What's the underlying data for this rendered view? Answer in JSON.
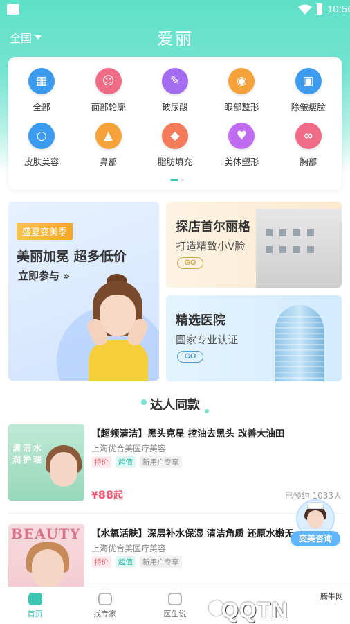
{
  "status_bar": {
    "time": "10:56"
  },
  "header": {
    "city": "全国",
    "title": "爱丽"
  },
  "categories": [
    {
      "label": "全部",
      "icon": "grid-icon",
      "color": "#3b9bf0",
      "glyph": "▦"
    },
    {
      "label": "面部轮廓",
      "icon": "face-icon",
      "color": "#f06c86",
      "glyph": "☺"
    },
    {
      "label": "玻尿酸",
      "icon": "syringe-icon",
      "color": "#a46cf0",
      "glyph": "✎"
    },
    {
      "label": "眼部整形",
      "icon": "eye-icon",
      "color": "#f6a23a",
      "glyph": "◉"
    },
    {
      "label": "除皱瘦脸",
      "icon": "bottle-icon",
      "color": "#3b9bf0",
      "glyph": "▣"
    },
    {
      "label": "皮肤美容",
      "icon": "mirror-icon",
      "color": "#3b9bf0",
      "glyph": "○"
    },
    {
      "label": "鼻部",
      "icon": "nose-icon",
      "color": "#f6a23a",
      "glyph": "▲"
    },
    {
      "label": "脂肪填充",
      "icon": "fat-icon",
      "color": "#f47c5a",
      "glyph": "◆"
    },
    {
      "label": "美体塑形",
      "icon": "body-icon",
      "color": "#c06cf0",
      "glyph": "♥"
    },
    {
      "label": "胸部",
      "icon": "bra-icon",
      "color": "#f06c86",
      "glyph": "∞"
    }
  ],
  "banners": {
    "left": {
      "tag": "盛夏变美季",
      "headline": "美丽加冕 超多低价",
      "cta": "立即参与 »"
    },
    "right_top": {
      "title": "探店首尔丽格",
      "subtitle": "打造精致小V脸",
      "button": "GO"
    },
    "right_bottom": {
      "title": "精选医院",
      "subtitle": "国家专业认证",
      "button": "GO"
    }
  },
  "section": {
    "title": "达人同款"
  },
  "items": [
    {
      "title": "【超频清洁】黑头克星 控油去黑头 改善大油田",
      "clinic": "上海优合美医疗美容",
      "tags": [
        "特价",
        "超值",
        "新用户专享"
      ],
      "price_symbol": "¥",
      "price": "88",
      "price_suffix": "起",
      "booked": "已预约 1033人",
      "thumb_text": "清洁水润护理"
    },
    {
      "title": "【水氧活肤】深层补水保湿 清洁角质 还原水嫩无",
      "clinic": "上海优合美医疗美容",
      "tags": [
        "特价",
        "超值",
        "新用户专享"
      ],
      "thumb_text": "BEAUTY"
    }
  ],
  "float_button": {
    "label": "变美咨询"
  },
  "tabs": [
    {
      "label": "首页",
      "icon": "home-icon",
      "active": true
    },
    {
      "label": "找专家",
      "icon": "expert-icon",
      "active": false
    },
    {
      "label": "医生说",
      "icon": "doctor-talk-icon",
      "active": false
    }
  ],
  "watermark": {
    "text": "QQTN",
    "top": "腾牛网"
  }
}
